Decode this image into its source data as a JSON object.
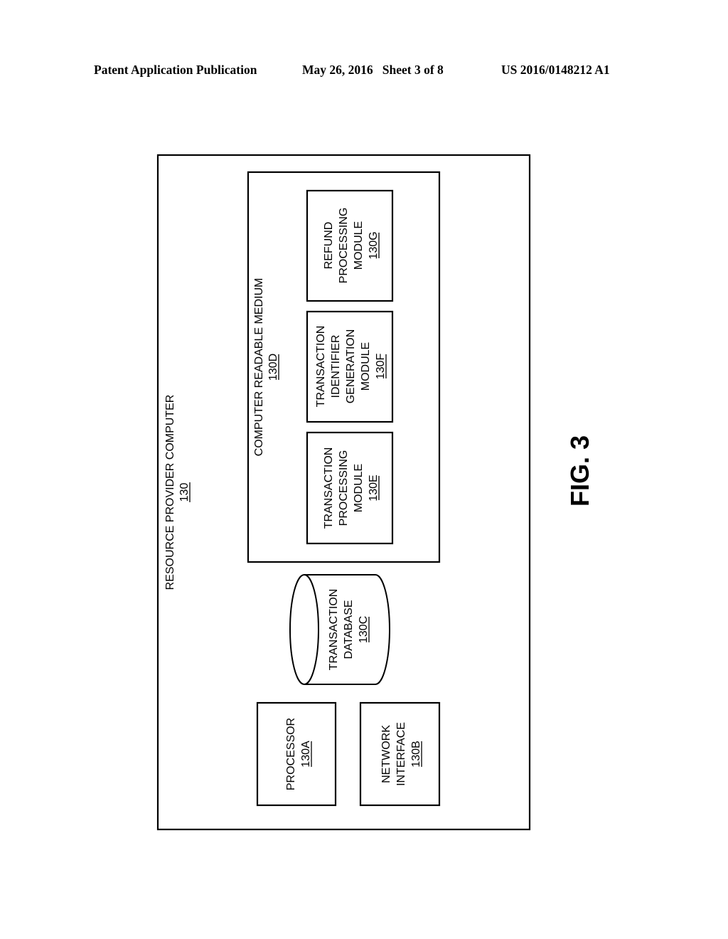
{
  "header": {
    "publication": "Patent Application Publication",
    "date_sheet": "May 26, 2016   Sheet 3 of 8",
    "patent_number": "US 2016/0148212 A1"
  },
  "diagram": {
    "orientation": "rotated 90° counter-clockwise",
    "outer": {
      "title": "RESOURCE PROVIDER COMPUTER",
      "ref": "130"
    },
    "processor": {
      "lines": [
        "PROCESSOR"
      ],
      "ref": "130A"
    },
    "network_interface": {
      "lines": [
        "NETWORK",
        "INTERFACE"
      ],
      "ref": "130B"
    },
    "database": {
      "lines": [
        "TRANSACTION",
        "DATABASE"
      ],
      "ref": "130C"
    },
    "medium": {
      "title": "COMPUTER READABLE MEDIUM",
      "ref": "130D",
      "modules": [
        {
          "lines": [
            "TRANSACTION",
            "PROCESSING",
            "MODULE"
          ],
          "ref": "130E"
        },
        {
          "lines": [
            "TRANSACTION",
            "IDENTIFIER",
            "GENERATION",
            "MODULE"
          ],
          "ref": "130F"
        },
        {
          "lines": [
            "REFUND",
            "PROCESSING",
            "MODULE"
          ],
          "ref": "130G"
        }
      ]
    },
    "figure_label": "FIG. 3"
  }
}
